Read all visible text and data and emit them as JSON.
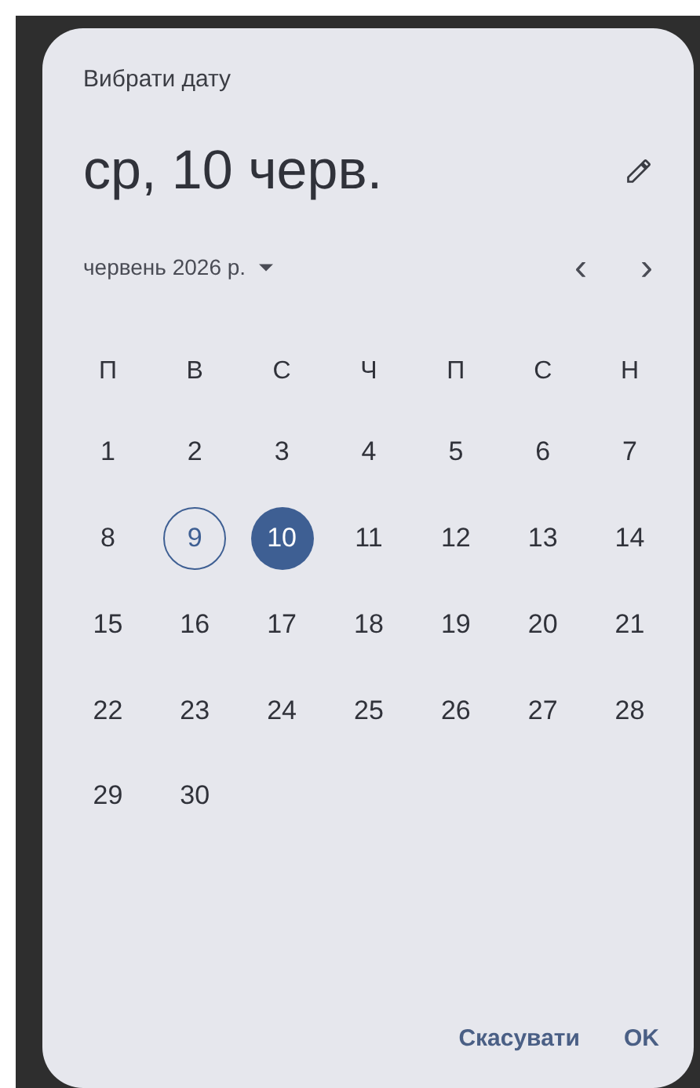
{
  "dialog": {
    "title": "Вибрати дату",
    "selected_date": "ср, 10 черв.",
    "month_label": "червень 2026 р.",
    "prev": "‹",
    "next": "›"
  },
  "weekdays": [
    "П",
    "В",
    "С",
    "Ч",
    "П",
    "С",
    "Н"
  ],
  "weeks": [
    [
      {
        "day": "1",
        "selected": false,
        "today": false
      },
      {
        "day": "2",
        "selected": false,
        "today": false
      },
      {
        "day": "3",
        "selected": false,
        "today": false
      },
      {
        "day": "4",
        "selected": false,
        "today": false
      },
      {
        "day": "5",
        "selected": false,
        "today": false
      },
      {
        "day": "6",
        "selected": false,
        "today": false
      },
      {
        "day": "7",
        "selected": false,
        "today": false
      }
    ],
    [
      {
        "day": "8",
        "selected": false,
        "today": false
      },
      {
        "day": "9",
        "selected": false,
        "today": true
      },
      {
        "day": "10",
        "selected": true,
        "today": false
      },
      {
        "day": "11",
        "selected": false,
        "today": false
      },
      {
        "day": "12",
        "selected": false,
        "today": false
      },
      {
        "day": "13",
        "selected": false,
        "today": false
      },
      {
        "day": "14",
        "selected": false,
        "today": false
      }
    ],
    [
      {
        "day": "15",
        "selected": false,
        "today": false
      },
      {
        "day": "16",
        "selected": false,
        "today": false
      },
      {
        "day": "17",
        "selected": false,
        "today": false
      },
      {
        "day": "18",
        "selected": false,
        "today": false
      },
      {
        "day": "19",
        "selected": false,
        "today": false
      },
      {
        "day": "20",
        "selected": false,
        "today": false
      },
      {
        "day": "21",
        "selected": false,
        "today": false
      }
    ],
    [
      {
        "day": "22",
        "selected": false,
        "today": false
      },
      {
        "day": "23",
        "selected": false,
        "today": false
      },
      {
        "day": "24",
        "selected": false,
        "today": false
      },
      {
        "day": "25",
        "selected": false,
        "today": false
      },
      {
        "day": "26",
        "selected": false,
        "today": false
      },
      {
        "day": "27",
        "selected": false,
        "today": false
      },
      {
        "day": "28",
        "selected": false,
        "today": false
      }
    ],
    [
      {
        "day": "29",
        "selected": false,
        "today": false
      },
      {
        "day": "30",
        "selected": false,
        "today": false
      }
    ]
  ],
  "buttons": [
    "Скасувати",
    "OK"
  ]
}
